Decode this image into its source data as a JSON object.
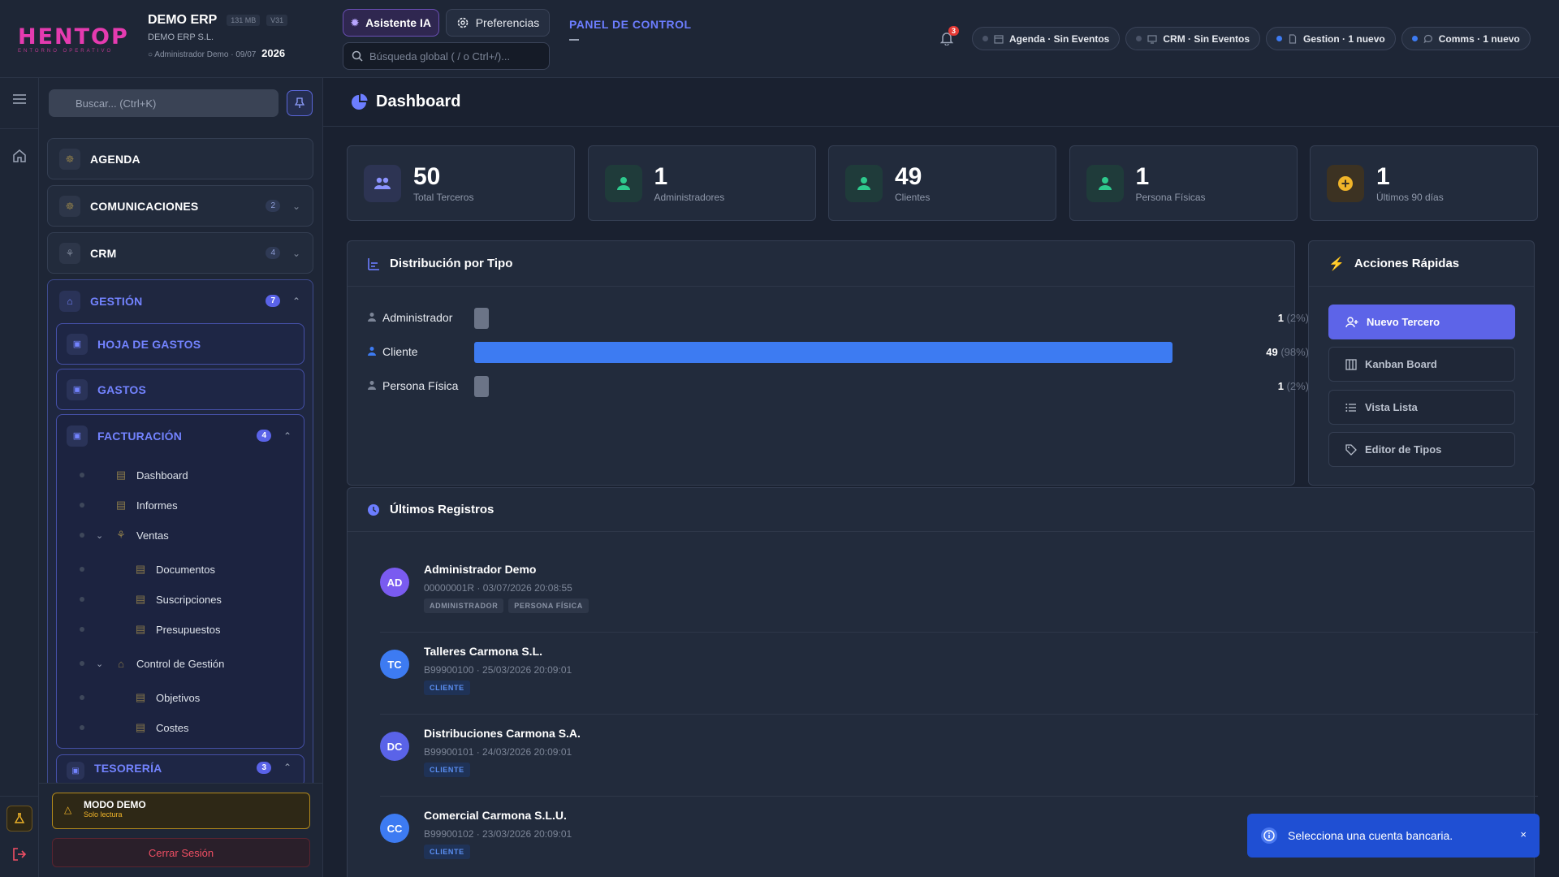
{
  "topbar": {
    "logo_text": "HENTOP",
    "logo_sub": "ENTORNO OPERATIVO",
    "company_name": "DEMO ERP",
    "size_chip": "131 MB",
    "version_chip": "V31",
    "company_legal": "DEMO ERP S.L.",
    "user_label": "Administrador Demo",
    "date_label": "09/07",
    "year_label": "2026",
    "ai_button": "Asistente IA",
    "prefs_button": "Preferencias",
    "search_placeholder": "Búsqueda global ( / o Ctrl+/)...",
    "panel_title": "PANEL DE CONTROL",
    "bell_count": "3",
    "pills": [
      {
        "label": "Agenda · Sin Eventos",
        "active": false
      },
      {
        "label": "CRM · Sin Eventos",
        "active": false
      },
      {
        "label": "Gestion · 1 nuevo",
        "active": true
      },
      {
        "label": "Comms · 1 nuevo",
        "active": true
      }
    ]
  },
  "sidebar": {
    "search_placeholder": "Buscar... (Ctrl+K)",
    "items": [
      {
        "label": "AGENDA",
        "count": ""
      },
      {
        "label": "COMUNICACIONES",
        "count": "2"
      },
      {
        "label": "CRM",
        "count": "4"
      }
    ],
    "gestion": {
      "label": "GESTIÓN",
      "count": "7",
      "sub_items": [
        {
          "label": "HOJA DE GASTOS"
        },
        {
          "label": "GASTOS"
        }
      ],
      "facturacion": {
        "label": "FACTURACIÓN",
        "count": "4",
        "tree": [
          {
            "label": "Dashboard"
          },
          {
            "label": "Informes"
          },
          {
            "label": "Ventas"
          },
          {
            "label": "Documentos"
          },
          {
            "label": "Suscripciones"
          },
          {
            "label": "Presupuestos"
          },
          {
            "label": "Control de Gestión"
          },
          {
            "label": "Objetivos"
          },
          {
            "label": "Costes"
          }
        ]
      },
      "tesoreria": {
        "label": "TESORERÍA",
        "count": "3"
      }
    },
    "demo_title": "MODO DEMO",
    "demo_sub": "Solo lectura",
    "logout": "Cerrar Sesión"
  },
  "main": {
    "title": "Dashboard",
    "stats": [
      {
        "value": "50",
        "label": "Total Terceros",
        "color": "#8b93ff",
        "bg": "#2d3453"
      },
      {
        "value": "1",
        "label": "Administradores",
        "color": "#2ec98d",
        "bg": "#1f3b3a"
      },
      {
        "value": "49",
        "label": "Clientes",
        "color": "#2ec98d",
        "bg": "#1f3b3a"
      },
      {
        "value": "1",
        "label": "Persona Físicas",
        "color": "#2ec98d",
        "bg": "#1f3b3a"
      },
      {
        "value": "1",
        "label": "Últimos 90 días",
        "color": "#f0b429",
        "bg": "#3c3222"
      }
    ],
    "distribution": {
      "title": "Distribución por Tipo",
      "rows": [
        {
          "name": "Administrador",
          "value": "1",
          "pct": "(2%)",
          "fraction": 0.02,
          "color": "#6b7487"
        },
        {
          "name": "Cliente",
          "value": "49",
          "pct": "(98%)",
          "fraction": 0.98,
          "color": "#3d7bf2"
        },
        {
          "name": "Persona Física",
          "value": "1",
          "pct": "(2%)",
          "fraction": 0.02,
          "color": "#6b7487"
        }
      ]
    },
    "quick_actions": {
      "title": "Acciones Rápidas",
      "buttons": [
        {
          "label": "Nuevo Tercero"
        },
        {
          "label": "Kanban Board"
        },
        {
          "label": "Vista Lista"
        },
        {
          "label": "Editor de Tipos"
        }
      ]
    },
    "records": {
      "title": "Últimos Registros",
      "items": [
        {
          "initials": "AD",
          "name": "Administrador Demo",
          "meta": "00000001R · 03/07/2026 20:08:55",
          "tags": [
            "ADMINISTRADOR",
            "PERSONA FÍSICA"
          ],
          "color": "#7a5bf0"
        },
        {
          "initials": "TC",
          "name": "Talleres Carmona S.L.",
          "meta": "B99900100 · 25/03/2026 20:09:01",
          "tags": [
            "CLIENTE"
          ],
          "color": "#3d7bf2"
        },
        {
          "initials": "DC",
          "name": "Distribuciones Carmona S.A.",
          "meta": "B99900101 · 24/03/2026 20:09:01",
          "tags": [
            "CLIENTE"
          ],
          "color": "#5a63e8"
        },
        {
          "initials": "CC",
          "name": "Comercial Carmona S.L.U.",
          "meta": "B99900102 · 23/03/2026 20:09:01",
          "tags": [
            "CLIENTE"
          ],
          "color": "#3d7bf2"
        }
      ]
    }
  },
  "toast": {
    "message": "Selecciona una cuenta bancaria.",
    "close": "×"
  }
}
